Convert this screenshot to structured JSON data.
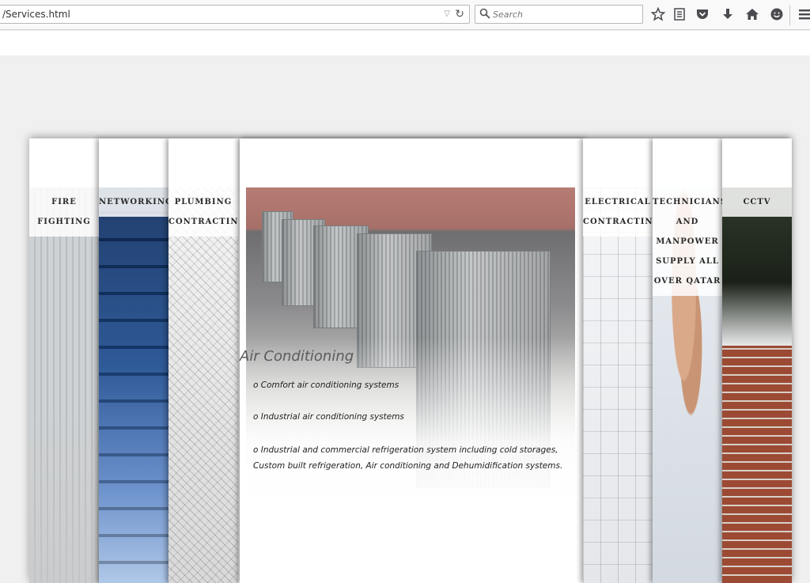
{
  "browser": {
    "url": "/Services.html",
    "search_placeholder": "Search"
  },
  "services": {
    "left_panels": [
      {
        "lines": [
          "FIRE",
          "FIGHTING"
        ]
      },
      {
        "lines": [
          "NETWORKING"
        ]
      },
      {
        "lines": [
          "PLUMBING",
          "CONTRACTING"
        ]
      }
    ],
    "right_panels": [
      {
        "lines": [
          "ELECTRICAL",
          "CONTRACTING"
        ]
      },
      {
        "lines": [
          "TECHNICIANS",
          "AND",
          "MANPOWER",
          "SUPPLY ALL",
          "OVER QATAR"
        ]
      },
      {
        "lines": [
          "CCTV"
        ]
      }
    ],
    "active": {
      "title": "Air Conditioning",
      "items": [
        "o Comfort air conditioning systems",
        "o Industrial air conditioning systems",
        "o Industrial and commercial refrigeration system including cold storages, Custom built refrigeration, Air conditioning and Dehumidification systems."
      ]
    }
  }
}
